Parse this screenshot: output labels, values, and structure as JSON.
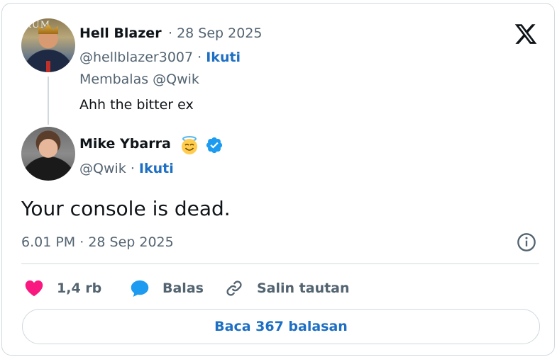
{
  "reply_tweet": {
    "author_name": "Hell Blazer",
    "date": "· 28 Sep 2025",
    "handle": "@hellblazer3007 ·",
    "follow_label": "Ikuti",
    "replying_to": "Membalas @Qwik",
    "text": "Ahh the bitter ex",
    "avatar_text": "RUM"
  },
  "main_tweet": {
    "author_name": "Mike Ybarra",
    "handle": "@Qwik ·",
    "follow_label": "Ikuti",
    "text": "Your console is dead.",
    "timestamp": "6.01 PM · 28 Sep 2025"
  },
  "actions": {
    "like_count": "1,4 rb",
    "reply_label": "Balas",
    "copy_link_label": "Salin tautan"
  },
  "read_replies_label": "Baca 367 balasan",
  "colors": {
    "accent": "#1d6fc4",
    "like": "#f91880",
    "verified": "#1d9bf0",
    "muted": "#536471",
    "border": "#cfd9de"
  },
  "icons": {
    "logo": "x-logo-icon",
    "emoji": "smiling-face-with-halo-icon",
    "verified": "verified-badge-icon",
    "info": "info-icon",
    "like": "heart-icon",
    "reply": "speech-bubble-icon",
    "copy_link": "link-icon"
  }
}
